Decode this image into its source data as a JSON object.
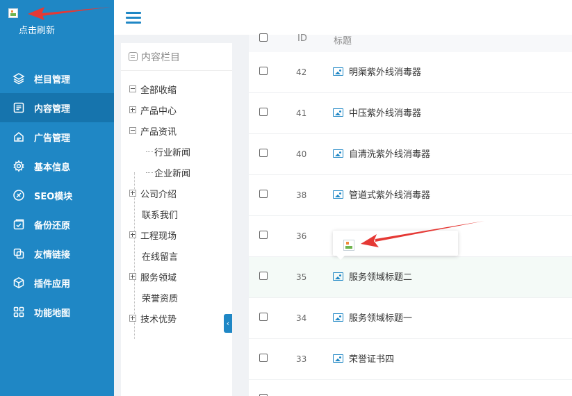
{
  "sidebar": {
    "refresh_label": "点击刷新",
    "items": [
      {
        "label": "栏目管理",
        "icon": "layers-icon"
      },
      {
        "label": "内容管理",
        "icon": "document-icon",
        "active": true
      },
      {
        "label": "广告管理",
        "icon": "ad-icon"
      },
      {
        "label": "基本信息",
        "icon": "gear-icon"
      },
      {
        "label": "SEO模块",
        "icon": "seo-icon"
      },
      {
        "label": "备份还原",
        "icon": "backup-icon"
      },
      {
        "label": "友情链接",
        "icon": "link-icon"
      },
      {
        "label": "插件应用",
        "icon": "cube-icon"
      },
      {
        "label": "功能地图",
        "icon": "grid-icon"
      }
    ]
  },
  "tree": {
    "header": "内容栏目",
    "items": [
      {
        "label": "全部收缩",
        "toggle": "minus"
      },
      {
        "label": "产品中心",
        "toggle": "plus"
      },
      {
        "label": "产品资讯",
        "toggle": "minus"
      },
      {
        "label": "行业新闻",
        "toggle": "child"
      },
      {
        "label": "企业新闻",
        "toggle": "child"
      },
      {
        "label": "公司介绍",
        "toggle": "plus"
      },
      {
        "label": "联系我们",
        "toggle": "none"
      },
      {
        "label": "工程现场",
        "toggle": "plus"
      },
      {
        "label": "在线留言",
        "toggle": "none"
      },
      {
        "label": "服务领域",
        "toggle": "plus"
      },
      {
        "label": "荣誉资质",
        "toggle": "none"
      },
      {
        "label": "技术优势",
        "toggle": "plus"
      }
    ]
  },
  "table": {
    "headers": {
      "id": "ID",
      "title": "标题"
    },
    "rows": [
      {
        "id": "42",
        "title": "明渠紫外线消毒器"
      },
      {
        "id": "41",
        "title": "中压紫外线消毒器"
      },
      {
        "id": "40",
        "title": "自清洗紫外线消毒器"
      },
      {
        "id": "38",
        "title": "管道式紫外线消毒器"
      },
      {
        "id": "36",
        "title": ""
      },
      {
        "id": "35",
        "title": "服务领域标题二"
      },
      {
        "id": "34",
        "title": "服务领域标题一"
      },
      {
        "id": "33",
        "title": "荣誉证书四"
      }
    ]
  },
  "colors": {
    "sidebar": "#1f87c5",
    "sidebar_active": "#1674ad",
    "arrow": "#e53935"
  }
}
